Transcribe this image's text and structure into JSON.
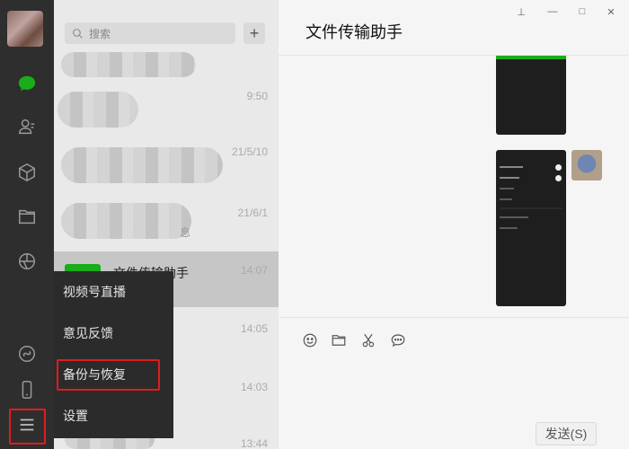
{
  "nav": {
    "icons": [
      "chat-icon",
      "contacts-icon",
      "favorites-icon",
      "files-icon",
      "moments-icon",
      "miniprogram-icon",
      "phone-icon",
      "menu-icon"
    ],
    "active_color": "#1aad19"
  },
  "search": {
    "placeholder": "搜索",
    "plus": "+"
  },
  "chats": [
    {
      "time": ""
    },
    {
      "time": "9:50"
    },
    {
      "time": "21/5/10"
    },
    {
      "time": "21/6/1",
      "snippet": "息"
    },
    {
      "time": "14:07",
      "title": "文件传输助手",
      "selected": true
    },
    {
      "time": "14:05"
    },
    {
      "time": "14:03"
    },
    {
      "time": "13:44"
    }
  ],
  "menu": {
    "items": [
      "视频号直播",
      "意见反馈",
      "备份与恢复",
      "设置"
    ],
    "highlighted_index": 2
  },
  "chat": {
    "title": "文件传输助手",
    "window_controls": [
      "⊥",
      "—",
      "□",
      "✕"
    ],
    "screenshot_rows": [
      "允许陌生人查看十条朋友圈",
      "朋友圈",
      "",
      "",
      "",
      "",
      ""
    ],
    "send_label": "发送(S)",
    "tools": [
      "emoji-icon",
      "folder-icon",
      "scissors-icon",
      "chat-bubble-icon"
    ]
  },
  "colors": {
    "highlight": "#e21b1b",
    "brand": "#1aad19"
  }
}
